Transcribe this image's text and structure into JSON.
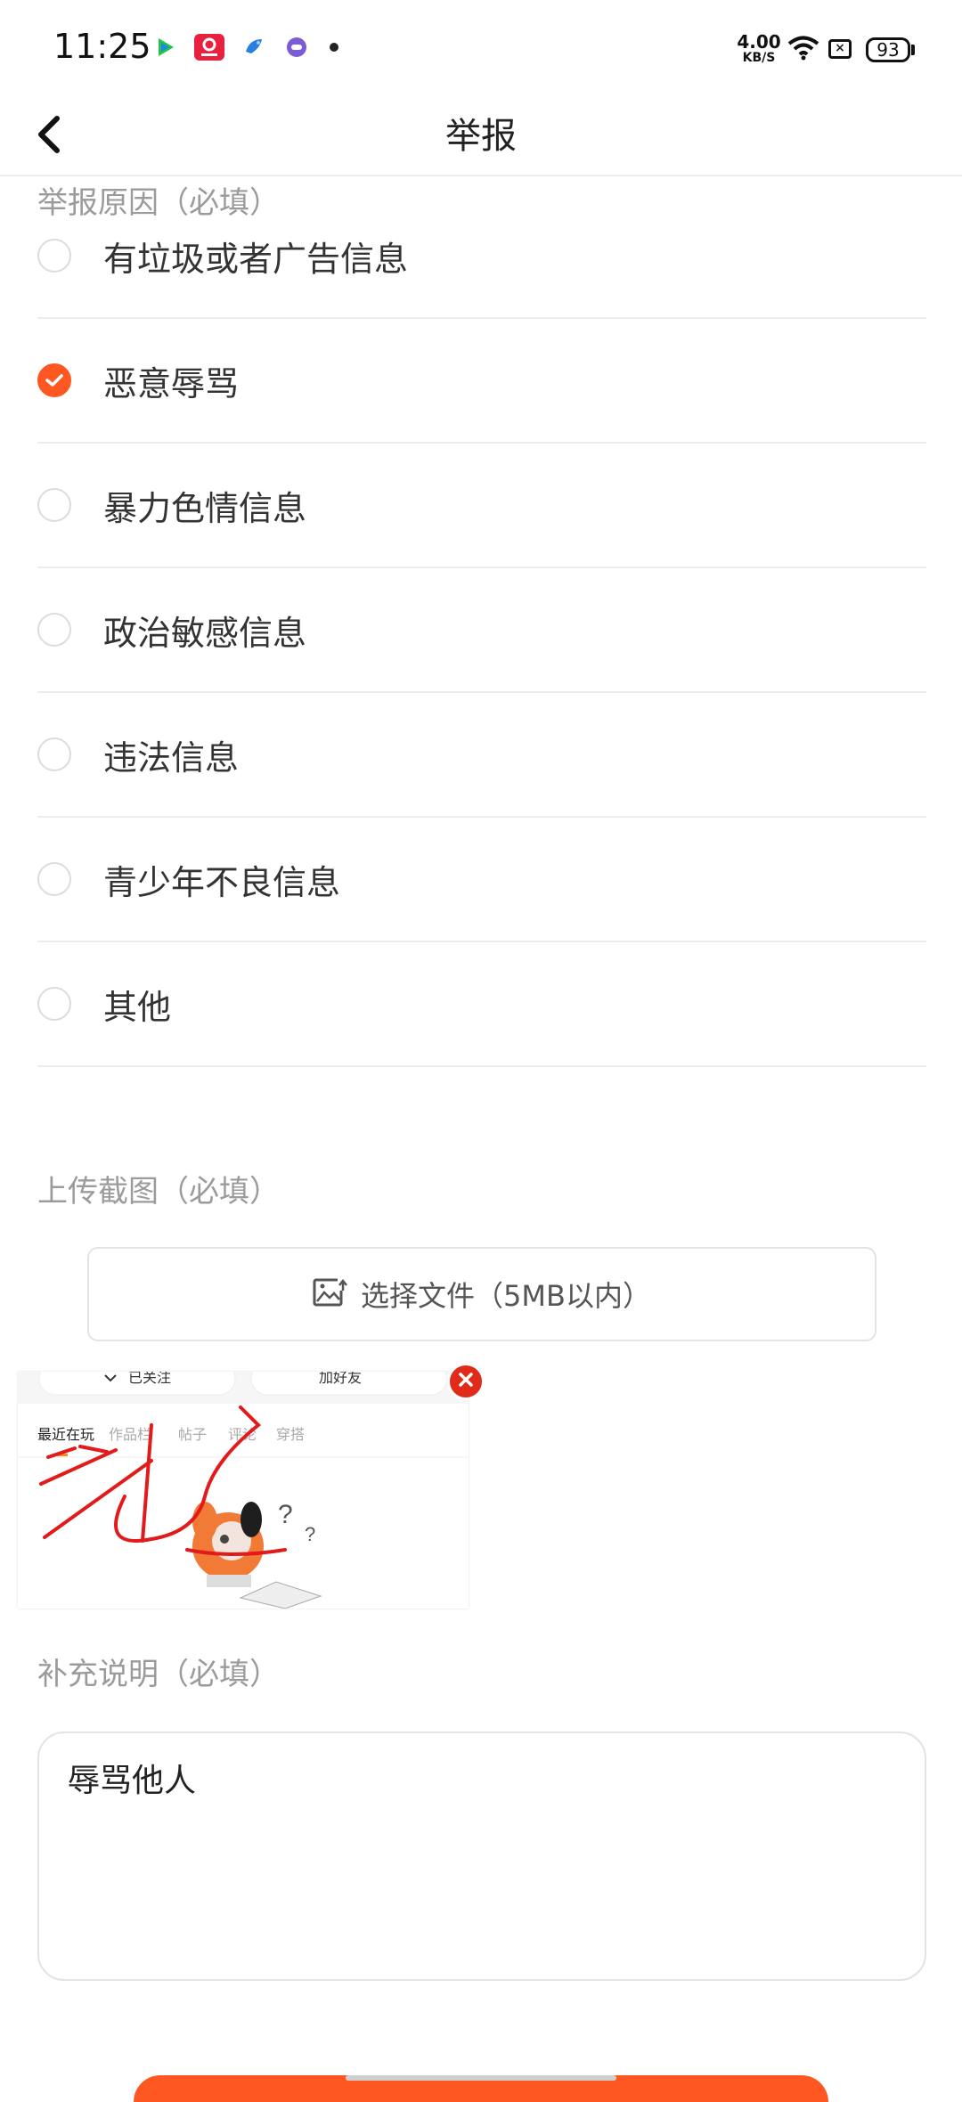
{
  "status_bar": {
    "time": "11:25",
    "net_speed_value": "4.00",
    "net_speed_unit": "KB/S",
    "battery": "93",
    "notification_icons": [
      "tencent-video-icon",
      "red-app-icon",
      "blue-bird-icon",
      "chat-bubble-icon"
    ],
    "icons": [
      "wifi-icon",
      "sim-icon",
      "battery-icon"
    ]
  },
  "nav": {
    "title": "举报",
    "back_icon": "chevron-left-icon"
  },
  "report_reason": {
    "label": "举报原因（必填）",
    "options": [
      {
        "label": "有垃圾或者广告信息",
        "checked": false
      },
      {
        "label": "恶意辱骂",
        "checked": true
      },
      {
        "label": "暴力色情信息",
        "checked": false
      },
      {
        "label": "政治敏感信息",
        "checked": false
      },
      {
        "label": "违法信息",
        "checked": false
      },
      {
        "label": "青少年不良信息",
        "checked": false
      },
      {
        "label": "其他",
        "checked": false
      }
    ]
  },
  "screenshot_upload": {
    "label": "上传截图（必填）",
    "button_label": "选择文件（5MB以内）",
    "button_icon": "image-upload-icon",
    "thumbnail": {
      "follow_label": "已关注",
      "add_friend_label": "加好友",
      "tabs": [
        "最近在玩",
        "作品栏",
        "帖子",
        "评论",
        "穿搭"
      ]
    }
  },
  "supplement": {
    "label": "补充说明（必填）",
    "value": "辱骂他人"
  },
  "colors": {
    "accent": "#ff5722",
    "remove_red": "#e02b1b",
    "label_gray": "#9b9b9b",
    "divider": "#ececec"
  }
}
